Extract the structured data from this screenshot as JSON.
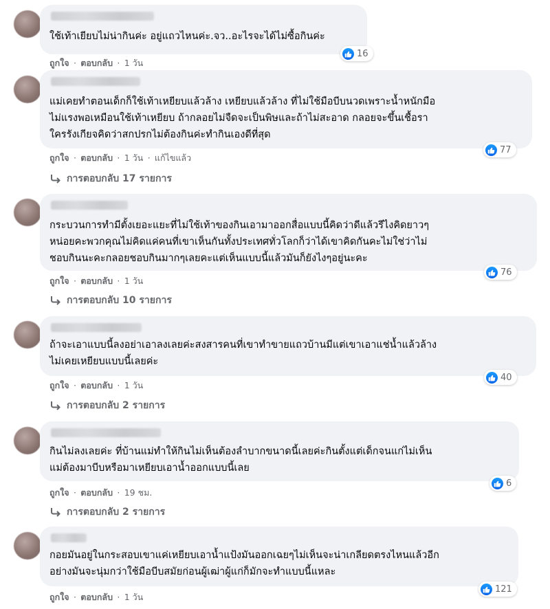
{
  "comments": [
    {
      "text": "ใช้เท้าเยียบไม่น่ากินค่ะ อยู่แถวไหนค่ะ.จว..อะไรจะได้ไม่ซื้อกินค่ะ",
      "reactions": "16",
      "like": "ถูกใจ",
      "reply": "ตอบกลับ",
      "time": "1 วัน",
      "edited": "",
      "replies_label": ""
    },
    {
      "text": "แม่เคยทำตอนเด็กก็ใช้เท้าเหยียบแล้วล้าง เหยียบแล้วล้าง ที่ไม่ใช้มือบีบนวดเพราะน้ำหนักมือ\nไม่แรงพอเหมือนใช้เท้าเหยียบ ถ้ากลอยไม่จืดจะเป็นพิษและถ้าไม่สะอาด กลอยจะขึ้นเชื้อรา\nใครรังเกียจคิดว่าสกปรกไม่ต้องกินค่ะทำกินเองดีที่สุด",
      "reactions": "77",
      "like": "ถูกใจ",
      "reply": "ตอบกลับ",
      "time": "1 วัน",
      "edited": "แก้ไขแล้ว",
      "replies_label": "การตอบกลับ 17 รายการ"
    },
    {
      "text": "กระบวนการทำมีตั้งเยอะแยะที่ไม่ใช้เท้าของกินเอามาออกสื่อแบบนี้คิดว่าดีแล้วรึไงคิดยาวๆ\nหน่อยคะพวกคุณไม่คิดแค่คนที่เขาเห็นกันทั้งประเทศทั่วโลกก็ว่าได้เขาคิดกันคะไม่ใช่ว่าไม่\nชอบกินนะคะกลอยชอบกินมากๆเลยคะแต่เห็นแบบนี้แล้วมันก็ยังไงๆอยู่นะคะ",
      "reactions": "76",
      "like": "ถูกใจ",
      "reply": "ตอบกลับ",
      "time": "1 วัน",
      "edited": "",
      "replies_label": "การตอบกลับ 10 รายการ"
    },
    {
      "text": "ถ้าจะเอาแบบนี้ลงอย่าเอาลงเลยค่ะสงสารคนที่เขาทำขายแถวบ้านมีแต่เขาเอาแช่น้ำแล้วล้าง\nไม่เคยเหยียบแบบนี้เลยค่ะ",
      "reactions": "40",
      "like": "ถูกใจ",
      "reply": "ตอบกลับ",
      "time": "1 วัน",
      "edited": "",
      "replies_label": "การตอบกลับ 2 รายการ"
    },
    {
      "text": "กินไม่ลงเลยค่ะ ที่บ้านแม่ทำให้กินไม่เห็นต้องลำบากขนาดนี้เลยค่ะกินตั้งแต่เด็กจนแก่ไม่เห็น\nแม่ต้องมาบีบหรือมาเหยียบเอาน้ำออกแบบนี้เลย",
      "reactions": "6",
      "like": "ถูกใจ",
      "reply": "ตอบกลับ",
      "time": "19 ชม.",
      "edited": "",
      "replies_label": "การตอบกลับ 2 รายการ"
    },
    {
      "text": "กอยมันอยู่ในกระสอบเขาแค่เหยียบเอาน้ำแป้งมันออกเฉยๆไม่เห็นจะน่าเกลียดตรงไหนแล้วอีก\nอย่างมันจะนุ่มกว่าใช้มือบีบสมัยก่อนผู้เฒ่าผู้แก่ก็มักจะทำแบบนี้แหละ",
      "reactions": "121",
      "like": "ถูกใจ",
      "reply": "ตอบกลับ",
      "time": "1 วัน",
      "edited": "",
      "replies_label": ""
    }
  ],
  "colors": {
    "bubble": "#f0f2f5",
    "meta_text": "#65676b",
    "like_blue": "#1877f2"
  },
  "icons": {
    "like": "thumbs-up-icon",
    "reply_arrow": "reply-arrow-icon"
  }
}
